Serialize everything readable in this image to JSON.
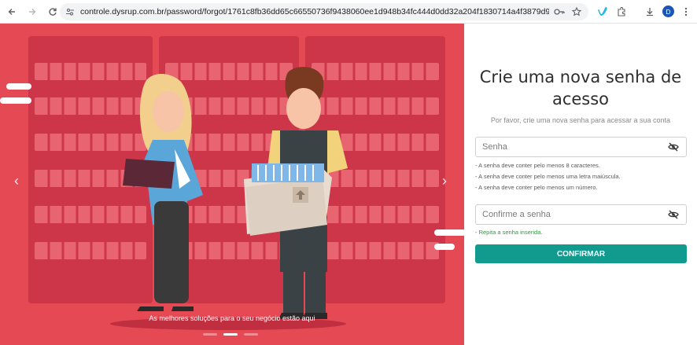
{
  "browser": {
    "url": "controle.dysrup.com.br/password/forgot/1761c8fb36dd65c66550736f9438060ee1d948b34fc444d0dd32a204f1830714a4f3879d944c729eb9e56883...",
    "avatar_letter": "D",
    "icons": [
      "back-icon",
      "forward-icon",
      "reload-icon",
      "site-info-icon",
      "password-key-icon",
      "star-icon",
      "vimeo-extension-icon",
      "puzzle-icon",
      "download-icon",
      "menu-icon"
    ]
  },
  "hero": {
    "caption": "As melhores soluções para o seu negócio estão aqui",
    "prev_arrow": "‹",
    "next_arrow": "›",
    "slides_total": 3,
    "active_slide": 2,
    "background_color": "#e54a54"
  },
  "form": {
    "title": "Crie uma nova senha de acesso",
    "subtitle": "Por favor, crie uma nova senha para acessar a sua conta",
    "password_placeholder": "Senha",
    "password_rules": [
      "- A senha deve conter pelo menos 8 caracteres.",
      "- A senha deve conter pelo menos uma letra maiúscula.",
      "- A senha deve conter pelo menos um número."
    ],
    "confirm_placeholder": "Confirme a senha",
    "confirm_hint": "- Repita a senha inserida.",
    "submit_label": "CONFIRMAR",
    "accent_color": "#119b8f"
  }
}
